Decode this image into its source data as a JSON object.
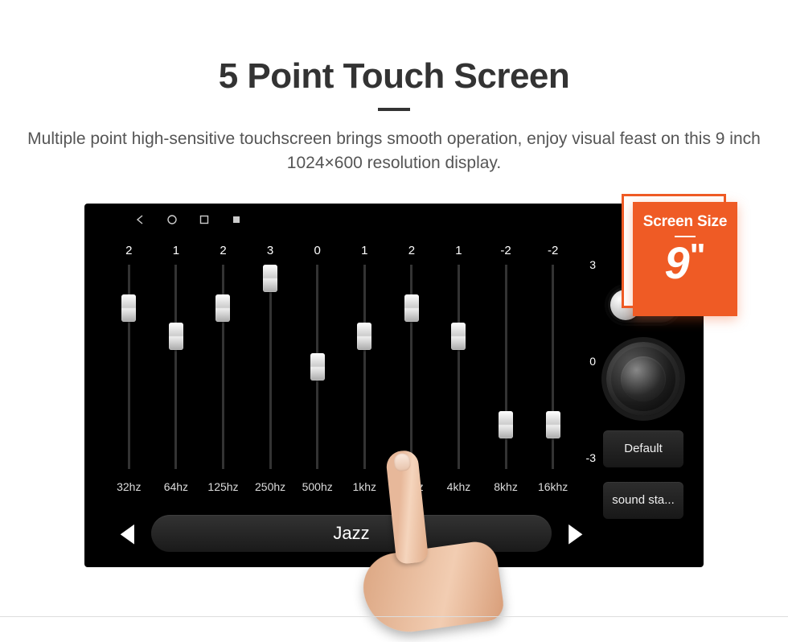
{
  "hero": {
    "title": "5 Point Touch Screen",
    "subtitle": "Multiple point high-sensitive touchscreen brings smooth operation, enjoy visual feast on this 9 inch 1024×600 resolution display."
  },
  "badge": {
    "label": "Screen Size",
    "value": "9",
    "unit": "\""
  },
  "equalizer": {
    "scale": {
      "max": "3",
      "mid": "0",
      "min": "-3"
    },
    "bands": [
      {
        "freq": "32hz",
        "value": "2",
        "pos": 0.17
      },
      {
        "freq": "64hz",
        "value": "1",
        "pos": 0.33
      },
      {
        "freq": "125hz",
        "value": "2",
        "pos": 0.17
      },
      {
        "freq": "250hz",
        "value": "3",
        "pos": 0.0
      },
      {
        "freq": "500hz",
        "value": "0",
        "pos": 0.5
      },
      {
        "freq": "1khz",
        "value": "1",
        "pos": 0.33
      },
      {
        "freq": "2khz",
        "value": "2",
        "pos": 0.17
      },
      {
        "freq": "4khz",
        "value": "1",
        "pos": 0.33
      },
      {
        "freq": "8khz",
        "value": "-2",
        "pos": 0.83
      },
      {
        "freq": "16khz",
        "value": "-2",
        "pos": 0.83
      }
    ],
    "preset": "Jazz"
  },
  "side": {
    "toggle_on": false,
    "default_label": "Default",
    "sound_label": "sound sta..."
  },
  "statusbar": {
    "icons_right": [
      "pin-icon",
      "phone-icon"
    ]
  }
}
